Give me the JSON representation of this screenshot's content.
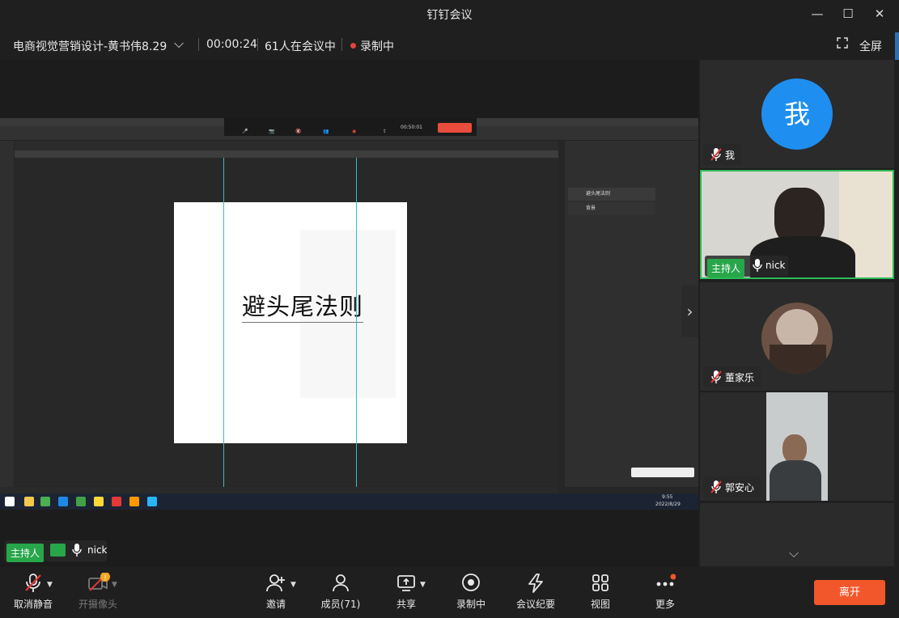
{
  "window": {
    "title": "钉钉会议",
    "controls": {
      "minimize": "—",
      "maximize": "☐",
      "close": "✕"
    }
  },
  "infobar": {
    "meeting_name": "电商视觉营销设计-黄书伟8.29",
    "elapsed": "00:00:24",
    "attendees": "61人在会议中",
    "recording": "录制中",
    "fullscreen": "全屏"
  },
  "screenshare": {
    "doc_text": "避头尾法则",
    "layers": [
      "避头尾法则",
      "背景"
    ],
    "timer": "00:50:01",
    "clock_time": "9:55",
    "clock_date": "2022/8/29"
  },
  "main_nameplate": {
    "host_badge": "主持人",
    "name": "nick"
  },
  "participants": [
    {
      "name": "我",
      "avatar_text": "我",
      "muted": true
    },
    {
      "name": "nick",
      "host_badge": "主持人",
      "muted": false,
      "active": true
    },
    {
      "name": "董家乐",
      "muted": true
    },
    {
      "name": "郭安心",
      "muted": true
    }
  ],
  "toolbar": {
    "unmute": "取消静音",
    "camera": "开摄像头",
    "invite": "邀请",
    "members": "成员(71)",
    "share": "共享",
    "recording": "录制中",
    "minutes": "会议纪要",
    "view": "视图",
    "more": "更多",
    "leave": "离开"
  },
  "colors": {
    "accent_blue": "#1e8ff0",
    "host_green": "#27a64a",
    "leave_orange": "#f2572c",
    "record_red": "#e0453b"
  }
}
